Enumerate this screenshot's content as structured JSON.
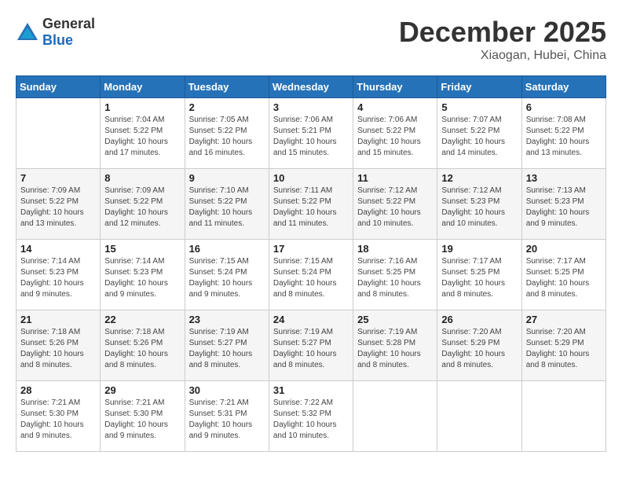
{
  "logo": {
    "general": "General",
    "blue": "Blue"
  },
  "header": {
    "month": "December 2025",
    "location": "Xiaogan, Hubei, China"
  },
  "weekdays": [
    "Sunday",
    "Monday",
    "Tuesday",
    "Wednesday",
    "Thursday",
    "Friday",
    "Saturday"
  ],
  "weeks": [
    [
      {
        "day": "",
        "info": ""
      },
      {
        "day": "1",
        "info": "Sunrise: 7:04 AM\nSunset: 5:22 PM\nDaylight: 10 hours and 17 minutes."
      },
      {
        "day": "2",
        "info": "Sunrise: 7:05 AM\nSunset: 5:22 PM\nDaylight: 10 hours and 16 minutes."
      },
      {
        "day": "3",
        "info": "Sunrise: 7:06 AM\nSunset: 5:21 PM\nDaylight: 10 hours and 15 minutes."
      },
      {
        "day": "4",
        "info": "Sunrise: 7:06 AM\nSunset: 5:22 PM\nDaylight: 10 hours and 15 minutes."
      },
      {
        "day": "5",
        "info": "Sunrise: 7:07 AM\nSunset: 5:22 PM\nDaylight: 10 hours and 14 minutes."
      },
      {
        "day": "6",
        "info": "Sunrise: 7:08 AM\nSunset: 5:22 PM\nDaylight: 10 hours and 13 minutes."
      }
    ],
    [
      {
        "day": "7",
        "info": "Sunrise: 7:09 AM\nSunset: 5:22 PM\nDaylight: 10 hours and 13 minutes."
      },
      {
        "day": "8",
        "info": "Sunrise: 7:09 AM\nSunset: 5:22 PM\nDaylight: 10 hours and 12 minutes."
      },
      {
        "day": "9",
        "info": "Sunrise: 7:10 AM\nSunset: 5:22 PM\nDaylight: 10 hours and 11 minutes."
      },
      {
        "day": "10",
        "info": "Sunrise: 7:11 AM\nSunset: 5:22 PM\nDaylight: 10 hours and 11 minutes."
      },
      {
        "day": "11",
        "info": "Sunrise: 7:12 AM\nSunset: 5:22 PM\nDaylight: 10 hours and 10 minutes."
      },
      {
        "day": "12",
        "info": "Sunrise: 7:12 AM\nSunset: 5:23 PM\nDaylight: 10 hours and 10 minutes."
      },
      {
        "day": "13",
        "info": "Sunrise: 7:13 AM\nSunset: 5:23 PM\nDaylight: 10 hours and 9 minutes."
      }
    ],
    [
      {
        "day": "14",
        "info": "Sunrise: 7:14 AM\nSunset: 5:23 PM\nDaylight: 10 hours and 9 minutes."
      },
      {
        "day": "15",
        "info": "Sunrise: 7:14 AM\nSunset: 5:23 PM\nDaylight: 10 hours and 9 minutes."
      },
      {
        "day": "16",
        "info": "Sunrise: 7:15 AM\nSunset: 5:24 PM\nDaylight: 10 hours and 9 minutes."
      },
      {
        "day": "17",
        "info": "Sunrise: 7:15 AM\nSunset: 5:24 PM\nDaylight: 10 hours and 8 minutes."
      },
      {
        "day": "18",
        "info": "Sunrise: 7:16 AM\nSunset: 5:25 PM\nDaylight: 10 hours and 8 minutes."
      },
      {
        "day": "19",
        "info": "Sunrise: 7:17 AM\nSunset: 5:25 PM\nDaylight: 10 hours and 8 minutes."
      },
      {
        "day": "20",
        "info": "Sunrise: 7:17 AM\nSunset: 5:25 PM\nDaylight: 10 hours and 8 minutes."
      }
    ],
    [
      {
        "day": "21",
        "info": "Sunrise: 7:18 AM\nSunset: 5:26 PM\nDaylight: 10 hours and 8 minutes."
      },
      {
        "day": "22",
        "info": "Sunrise: 7:18 AM\nSunset: 5:26 PM\nDaylight: 10 hours and 8 minutes."
      },
      {
        "day": "23",
        "info": "Sunrise: 7:19 AM\nSunset: 5:27 PM\nDaylight: 10 hours and 8 minutes."
      },
      {
        "day": "24",
        "info": "Sunrise: 7:19 AM\nSunset: 5:27 PM\nDaylight: 10 hours and 8 minutes."
      },
      {
        "day": "25",
        "info": "Sunrise: 7:19 AM\nSunset: 5:28 PM\nDaylight: 10 hours and 8 minutes."
      },
      {
        "day": "26",
        "info": "Sunrise: 7:20 AM\nSunset: 5:29 PM\nDaylight: 10 hours and 8 minutes."
      },
      {
        "day": "27",
        "info": "Sunrise: 7:20 AM\nSunset: 5:29 PM\nDaylight: 10 hours and 8 minutes."
      }
    ],
    [
      {
        "day": "28",
        "info": "Sunrise: 7:21 AM\nSunset: 5:30 PM\nDaylight: 10 hours and 9 minutes."
      },
      {
        "day": "29",
        "info": "Sunrise: 7:21 AM\nSunset: 5:30 PM\nDaylight: 10 hours and 9 minutes."
      },
      {
        "day": "30",
        "info": "Sunrise: 7:21 AM\nSunset: 5:31 PM\nDaylight: 10 hours and 9 minutes."
      },
      {
        "day": "31",
        "info": "Sunrise: 7:22 AM\nSunset: 5:32 PM\nDaylight: 10 hours and 10 minutes."
      },
      {
        "day": "",
        "info": ""
      },
      {
        "day": "",
        "info": ""
      },
      {
        "day": "",
        "info": ""
      }
    ]
  ]
}
